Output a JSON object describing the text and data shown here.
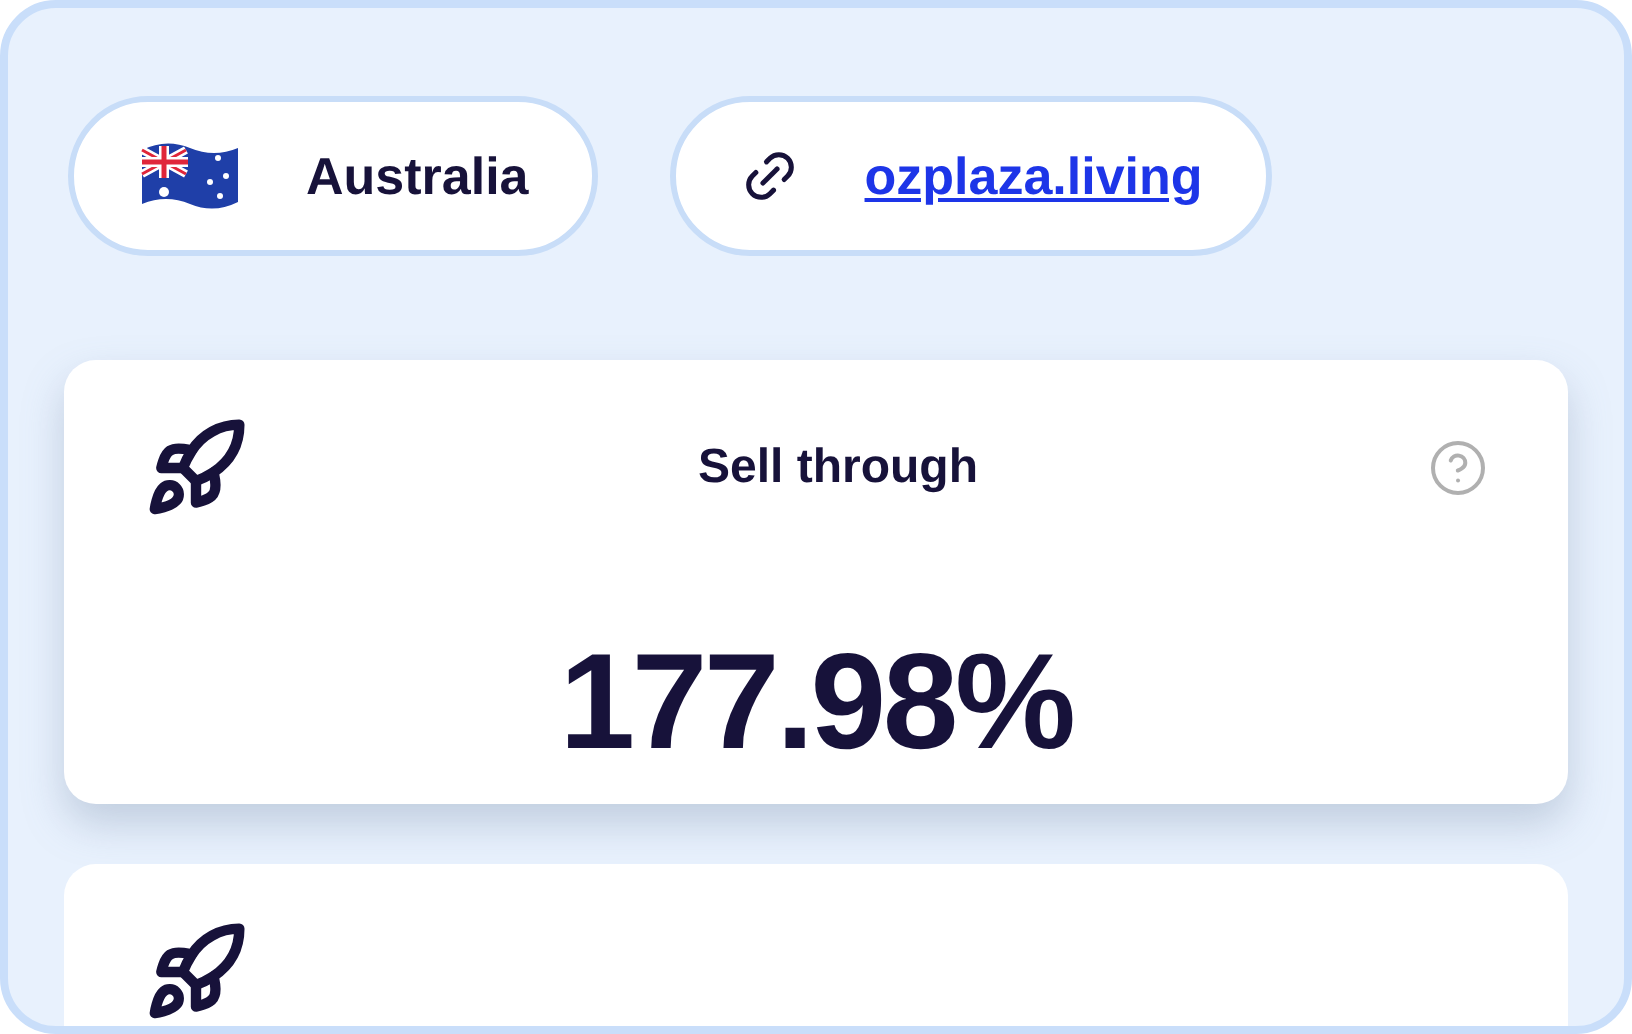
{
  "chips": [
    {
      "kind": "country",
      "label": "Australia"
    },
    {
      "kind": "link",
      "label": "ozplaza.living"
    }
  ],
  "cards": [
    {
      "title": "Sell through",
      "value": "177.98%"
    }
  ]
}
